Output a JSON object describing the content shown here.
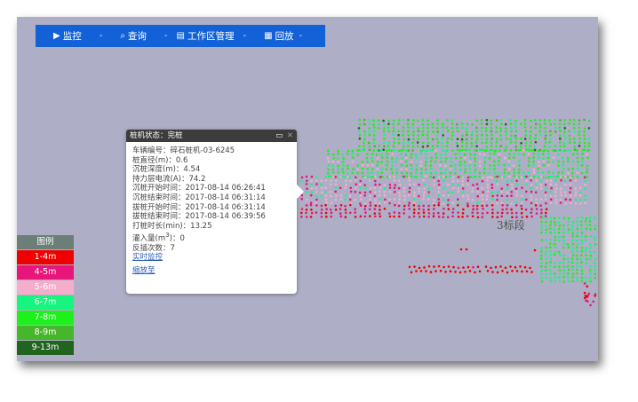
{
  "nav": {
    "items": [
      {
        "icon": "▶",
        "label": "监控"
      },
      {
        "icon": "⌕",
        "label": "查询"
      },
      {
        "icon": "▤",
        "label": "工作区管理"
      },
      {
        "icon": "▦",
        "label": "回放"
      }
    ],
    "separator": "-"
  },
  "popup": {
    "title": "桩机状态：完桩",
    "rows": [
      "车辆编号：碎石桩机-03-6245",
      "桩直径(m)：0.6",
      "沉桩深度(m)：4.54",
      "持力层电流(A)：74.2",
      "沉桩开始时间：2017-08-14 06:26:41",
      "沉桩结束时间：2017-08-14 06:31:14",
      "拔桩开始时间：2017-08-14 06:31:14",
      "拔桩结束时间：2017-08-14 06:39:56",
      "打桩时长(min)：13.25"
    ],
    "fill_label": "灌入量(m",
    "fill_sup": "3",
    "fill_value": ")：0",
    "reinsert": "反插次数：7",
    "link_monitor": "实时监控",
    "link_zoom": "缩放至"
  },
  "section_label": "3标段",
  "legend": {
    "title": "图例",
    "items": [
      {
        "label": "1-4m",
        "color": "#f00000"
      },
      {
        "label": "4-5m",
        "color": "#e8157a"
      },
      {
        "label": "5-6m",
        "color": "#f4aecb"
      },
      {
        "label": "6-7m",
        "color": "#16f580"
      },
      {
        "label": "7-8m",
        "color": "#1cf11c"
      },
      {
        "label": "8-9m",
        "color": "#46b62a"
      },
      {
        "label": "9-13m",
        "color": "#22631f"
      }
    ]
  }
}
